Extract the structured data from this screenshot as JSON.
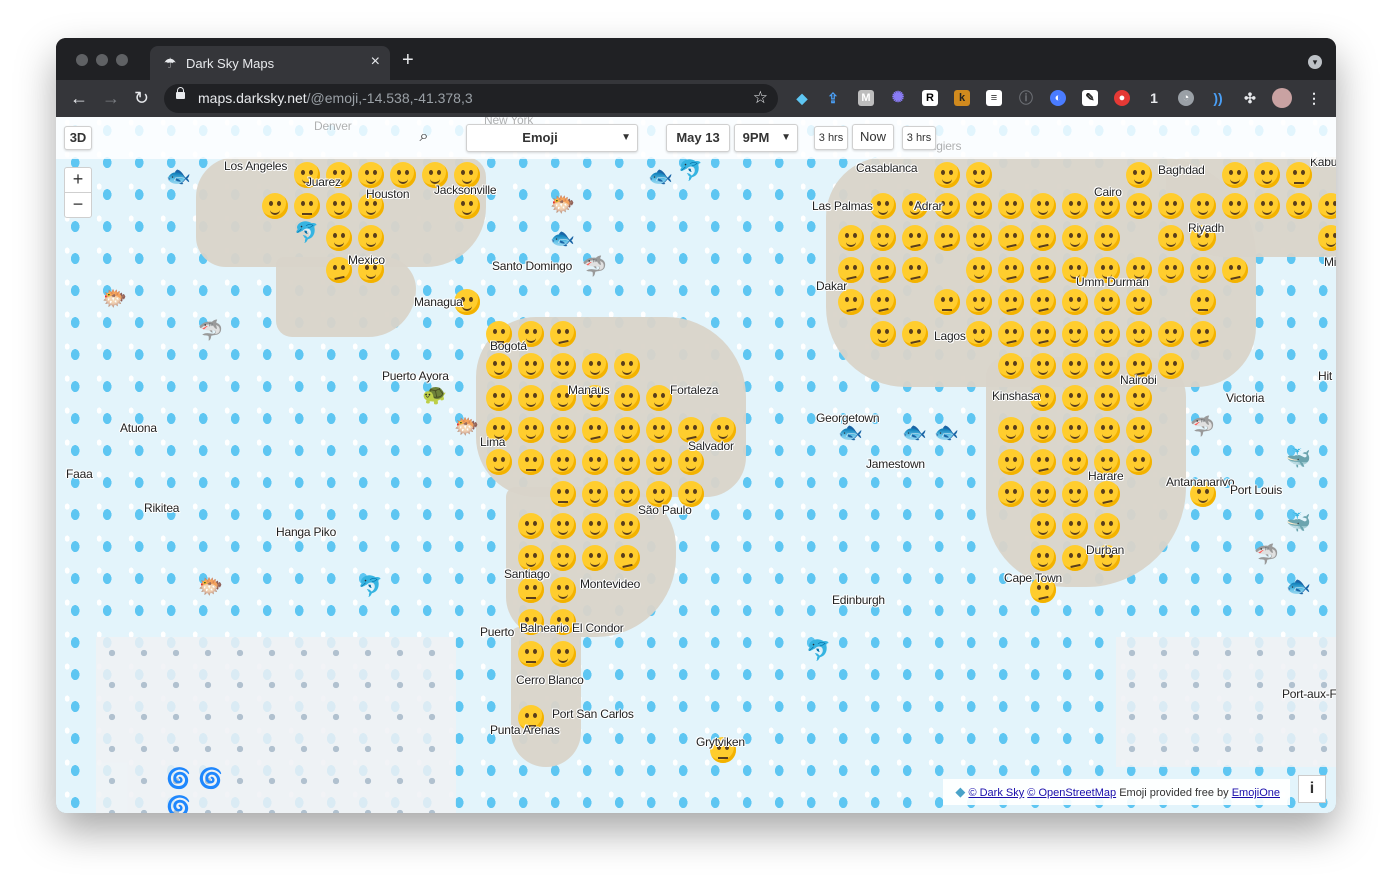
{
  "browser": {
    "tab_title": "Dark Sky Maps",
    "tab_favicon": "umbrella-icon",
    "new_tab_icon": "+",
    "close_icon": "×",
    "url_host": "maps.darksky.net",
    "url_path": "/@emoji,-14.538,-41.378,3",
    "extension_badge_count": "1"
  },
  "map_controls": {
    "view_3d": "3D",
    "layer_select": "Emoji",
    "date": "May 13",
    "time": "9PM",
    "back_step": "3 hrs",
    "now": "Now",
    "forward_step": "3 hrs",
    "zoom_in": "+",
    "zoom_out": "−",
    "dropdown_arrow": "▼"
  },
  "map_labels": {
    "los_angeles": "Los Angeles",
    "juarez": "Juarez",
    "houston": "Houston",
    "jacksonville": "Jacksonville",
    "mexico": "Mexico",
    "santo_domingo": "Santo Domingo",
    "managua": "Managua",
    "bogota": "Bogotá",
    "puerto_ayora": "Puerto Ayora",
    "manaus": "Manaus",
    "fortaleza": "Fortaleza",
    "lima": "Lima",
    "salvador": "Salvador",
    "atuona": "Atuona",
    "faaa": "Faaa",
    "rikitea": "Rikitea",
    "hanga_piko": "Hanga Piko",
    "sao_paulo": "São Paulo",
    "santiago": "Santiago",
    "montevideo": "Montevideo",
    "puerto": "Puerto",
    "balneario": "Balneario El Condor",
    "cerro_blanco": "Cerro Blanco",
    "port_san_carlos": "Port San Carlos",
    "punta_arenas": "Punta Arenas",
    "grytviken": "Grytviken",
    "casablanca": "Casablanca",
    "las_palmas": "Las Palmas",
    "adrar": "Adrar",
    "cairo": "Cairo",
    "baghdad": "Baghdad",
    "riyadh": "Riyadh",
    "kabul": "Kabu",
    "dakar": "Dakar",
    "umm_durman": "Umm Durman",
    "lagos": "Lagos",
    "nairobi": "Nairobi",
    "kinshasa": "Kinshasa",
    "georgetown": "Georgetown",
    "victoria": "Victoria",
    "jamestown": "Jamestown",
    "harare": "Harare",
    "antananarivo": "Antananarivo",
    "port_louis": "Port Louis",
    "durban": "Durban",
    "cape_town": "Cape Town",
    "edinburgh": "Edinburgh",
    "port_aux": "Port-aux-F",
    "mi": "Mi",
    "hit": "Hit",
    "denver": "Denver",
    "new_york": "New York",
    "algiers": "Algiers"
  },
  "attribution": {
    "dark_sky": "© Dark Sky",
    "osm": "© OpenStreetMap",
    "emoji_text": "Emoji provided free by",
    "emojione": "EmojiOne",
    "info": "i"
  }
}
